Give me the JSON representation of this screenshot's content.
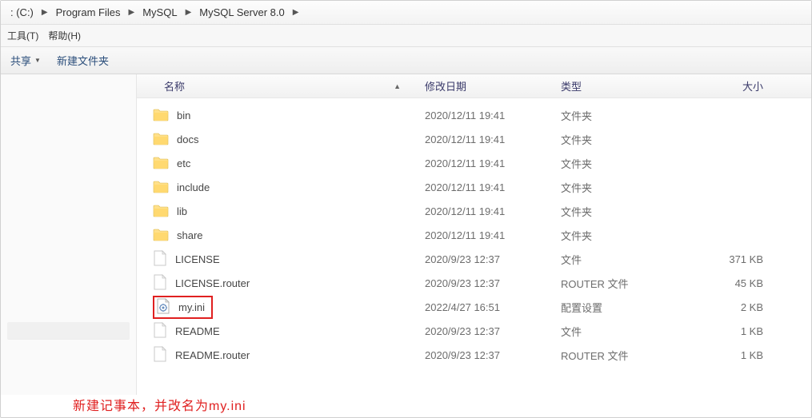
{
  "breadcrumb": {
    "drive": ": (C:)",
    "p1": "Program Files",
    "p2": "MySQL",
    "p3": "MySQL Server 8.0"
  },
  "menubar": {
    "tools": "工具(T)",
    "help": "帮助(H)"
  },
  "toolbar": {
    "share": "共享",
    "new_folder": "新建文件夹"
  },
  "columns": {
    "name": "名称",
    "date": "修改日期",
    "type": "类型",
    "size": "大小"
  },
  "types": {
    "folder": "文件夹",
    "file": "文件",
    "router": "ROUTER 文件",
    "config": "配置设置"
  },
  "files": [
    {
      "name": "bin",
      "date": "2020/12/11 19:41",
      "type_key": "folder",
      "size": "",
      "icon": "folder"
    },
    {
      "name": "docs",
      "date": "2020/12/11 19:41",
      "type_key": "folder",
      "size": "",
      "icon": "folder"
    },
    {
      "name": "etc",
      "date": "2020/12/11 19:41",
      "type_key": "folder",
      "size": "",
      "icon": "folder"
    },
    {
      "name": "include",
      "date": "2020/12/11 19:41",
      "type_key": "folder",
      "size": "",
      "icon": "folder"
    },
    {
      "name": "lib",
      "date": "2020/12/11 19:41",
      "type_key": "folder",
      "size": "",
      "icon": "folder"
    },
    {
      "name": "share",
      "date": "2020/12/11 19:41",
      "type_key": "folder",
      "size": "",
      "icon": "folder"
    },
    {
      "name": "LICENSE",
      "date": "2020/9/23 12:37",
      "type_key": "file",
      "size": "371 KB",
      "icon": "file"
    },
    {
      "name": "LICENSE.router",
      "date": "2020/9/23 12:37",
      "type_key": "router",
      "size": "45 KB",
      "icon": "file"
    },
    {
      "name": "my.ini",
      "date": "2022/4/27 16:51",
      "type_key": "config",
      "size": "2 KB",
      "icon": "ini",
      "highlight": true
    },
    {
      "name": "README",
      "date": "2020/9/23 12:37",
      "type_key": "file",
      "size": "1 KB",
      "icon": "file"
    },
    {
      "name": "README.router",
      "date": "2020/9/23 12:37",
      "type_key": "router",
      "size": "1 KB",
      "icon": "file"
    }
  ],
  "annotation": "新建记事本，并改名为my.ini"
}
